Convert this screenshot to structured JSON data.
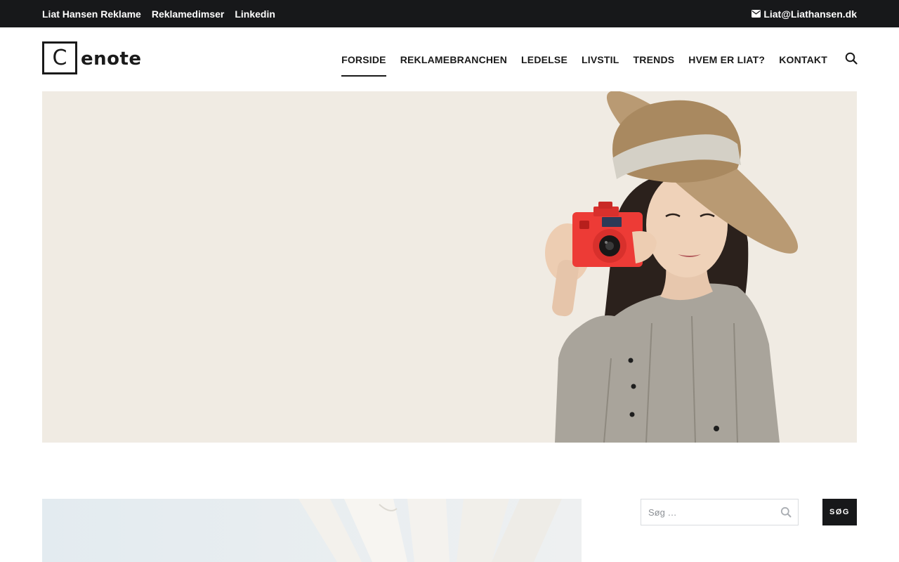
{
  "topbar": {
    "links": [
      "Liat Hansen Reklame",
      "Reklamedimser",
      "Linkedin"
    ],
    "contact_email": "Liat@Liathansen.dk",
    "contact_icon": "envelope-icon"
  },
  "logo": {
    "letter": "C",
    "text": "enote"
  },
  "nav": {
    "items": [
      "FORSIDE",
      "REKLAMEBRANCHEN",
      "LEDELSE",
      "LIVSTIL",
      "TRENDS",
      "HVEM ER LIAT?",
      "KONTAKT"
    ],
    "active": "FORSIDE",
    "search_icon": "search-icon"
  },
  "hero": {
    "image": "woman-with-straw-hat-and-red-camera"
  },
  "post": {
    "image": "white-flower-petals"
  },
  "sidebar": {
    "search": {
      "placeholder": "Søg …",
      "button_label": "SØG"
    }
  },
  "colors": {
    "topbar_bg": "#17181a",
    "hero_bg": "#f0ebe3",
    "accent": "#ed3b36",
    "text": "#1a1a1a"
  }
}
